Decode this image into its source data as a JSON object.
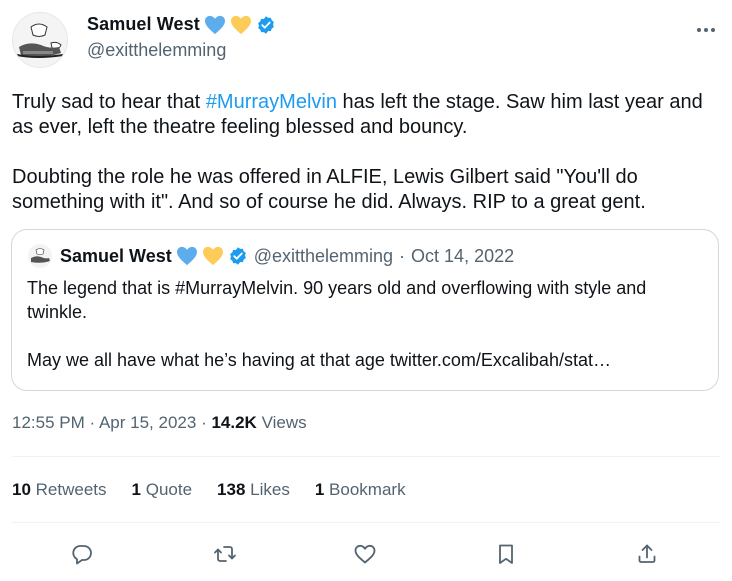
{
  "author": {
    "name": "Samuel West",
    "handle": "@exitthelemming",
    "emoji": [
      "blue-heart",
      "yellow-heart"
    ],
    "verified_color": "#1d9bf0"
  },
  "tweet": {
    "part1": "Truly sad to hear that ",
    "hashtag": "#MurrayMelvin",
    "part2": " has left the stage. Saw him last year and as ever, left the theatre feeling blessed and bouncy.\n\nDoubting the role he was offered in ALFIE, Lewis Gilbert said \"You'll do something with it\". And so of course he did. Always. RIP to a great gent."
  },
  "quote": {
    "name": "Samuel West",
    "handle": "@exitthelemming",
    "separator": "·",
    "date": "Oct 14, 2022",
    "text": "The legend that is #MurrayMelvin. 90 years old and overflowing with style and twinkle.\n\nMay we all have what he’s having at that age twitter.com/Excalibah/stat…"
  },
  "meta": {
    "time": "12:55 PM",
    "sep1": "·",
    "date": "Apr 15, 2023",
    "sep2": "·",
    "views_count": "14.2K",
    "views_label": "Views"
  },
  "stats": {
    "retweets_count": "10",
    "retweets_label": "Retweets",
    "quotes_count": "1",
    "quotes_label": "Quote",
    "likes_count": "138",
    "likes_label": "Likes",
    "bookmarks_count": "1",
    "bookmarks_label": "Bookmark"
  },
  "colors": {
    "accent": "#1d9bf0",
    "muted": "#536471",
    "border": "#cfd9de",
    "text": "#0f1419",
    "heart_blue": "#5dadec",
    "heart_yellow": "#fdcb58"
  },
  "icons": [
    "more-icon",
    "reply-icon",
    "retweet-icon",
    "like-icon",
    "bookmark-icon",
    "share-icon",
    "verified-icon"
  ]
}
